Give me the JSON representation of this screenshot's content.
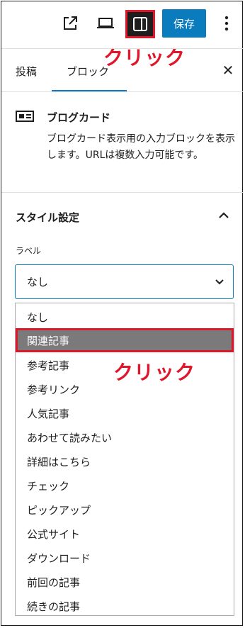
{
  "toolbar": {
    "save_label": "保存",
    "annotation_top": "クリック"
  },
  "tabs": [
    {
      "label": "投稿"
    },
    {
      "label": "ブロック"
    }
  ],
  "close_glyph": "✕",
  "block": {
    "title": "ブログカード",
    "description": "ブログカード表示用の入力ブロックを表示します。URLは複数入力可能です。"
  },
  "style_section": {
    "title": "スタイル設定",
    "field_label": "ラベル",
    "selected_value": "なし"
  },
  "dropdown": {
    "options": [
      {
        "label": "なし"
      },
      {
        "label": "関連記事"
      },
      {
        "label": "参考記事"
      },
      {
        "label": "参考リンク"
      },
      {
        "label": "人気記事"
      },
      {
        "label": "あわせて読みたい"
      },
      {
        "label": "詳細はこちら"
      },
      {
        "label": "チェック"
      },
      {
        "label": "ピックアップ"
      },
      {
        "label": "公式サイト"
      },
      {
        "label": "ダウンロード"
      },
      {
        "label": "前回の記事"
      },
      {
        "label": "続きの記事"
      }
    ],
    "highlighted": "関連記事"
  },
  "annotation_list": "クリック",
  "colors": {
    "accent": "#0a7bbd",
    "annotation": "#e0162b",
    "highlight": "#7a7a7a"
  }
}
